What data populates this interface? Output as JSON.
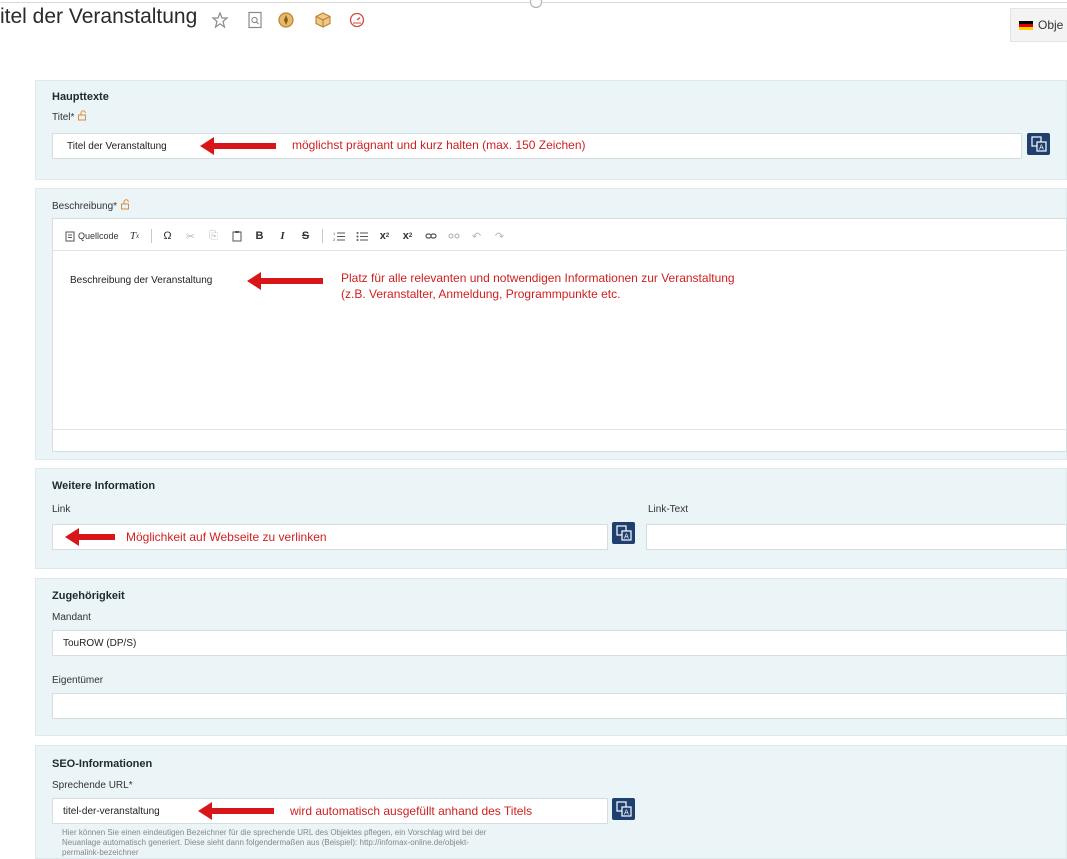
{
  "header": {
    "title": "itel der Veranstaltung",
    "language_label": "Obje",
    "icons": [
      "star-icon",
      "search-doc-icon",
      "compass-icon",
      "package-icon",
      "gauge-icon"
    ]
  },
  "hauptteile": {
    "section_title": "Haupttexte",
    "title_label": "Titel*",
    "title_value": "Titel der Veranstaltung",
    "title_note": "möglichst prägnant und kurz halten (max. 150 Zeichen)"
  },
  "description": {
    "label": "Beschreibung*",
    "toolbar": {
      "source_label": "Quellcode",
      "tools": [
        "Tx",
        "Ω",
        "✂",
        "⎘",
        "📋",
        "B",
        "I",
        "S",
        "list-ol",
        "list-ul",
        "sub",
        "sup",
        "link",
        "unlink",
        "undo",
        "redo"
      ]
    },
    "content": "Beschreibung der Veranstaltung",
    "note_line1": "Platz für alle relevanten und notwendigen Informationen zur Veranstaltung",
    "note_line2": "(z.B. Veranstalter, Anmeldung, Programmpunkte etc."
  },
  "weitere": {
    "section_title": "Weitere Information",
    "link_label": "Link",
    "link_text_label": "Link-Text",
    "link_note": "Möglichkeit auf Webseite zu verlinken",
    "link_value": "",
    "link_text_value": ""
  },
  "zugehoerigkeit": {
    "section_title": "Zugehörigkeit",
    "mandant_label": "Mandant",
    "mandant_value": "TouROW (DP/S)",
    "owner_label": "Eigentümer",
    "owner_value": ""
  },
  "seo": {
    "section_title": "SEO-Informationen",
    "url_label": "Sprechende URL*",
    "url_value": "titel-der-veranstaltung",
    "url_note": "wird automatisch ausgefüllt anhand des Titels",
    "hint_line1": "Hier können Sie einen eindeutigen Bezeichner für die sprechende URL des Objektes pflegen, ein Vorschlag wird bei der",
    "hint_line2": "Neuanlage automatisch generiert. Diese sieht dann folgendermaßen aus (Beispiel): http://infomax-online.de/objekt-",
    "hint_line3": "permalink-bezeichner"
  },
  "colors": {
    "panel_bg": "#ebf4f6",
    "arrow": "#d8161a",
    "translate_button": "#1f3f6e"
  }
}
